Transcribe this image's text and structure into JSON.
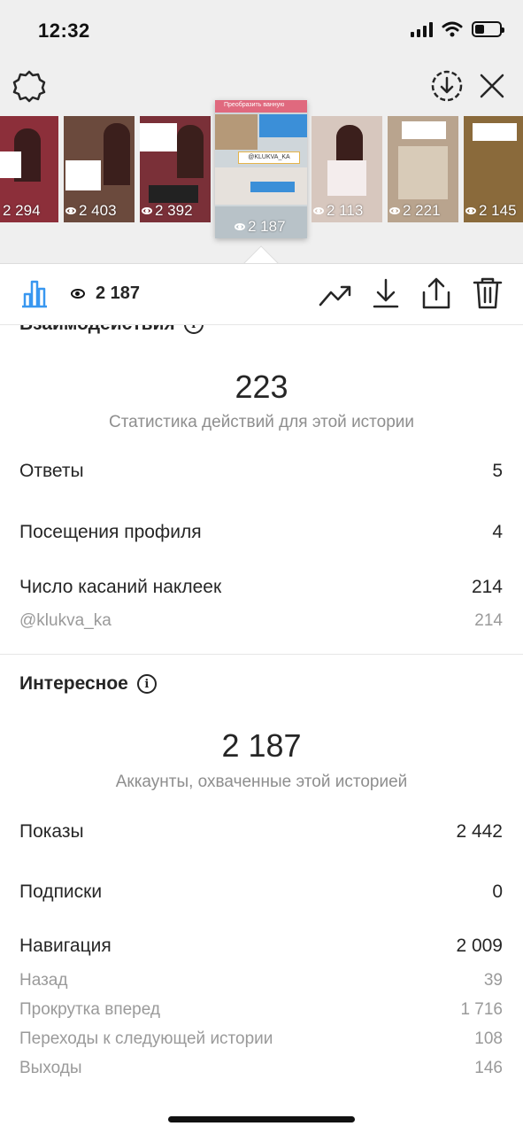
{
  "status": {
    "time": "12:32"
  },
  "stories": [
    {
      "views": "2 294",
      "bg": "#8c2f3a"
    },
    {
      "views": "2 403",
      "bg": "#6b4a3d"
    },
    {
      "views": "2 392",
      "bg": "#7a3038"
    },
    {
      "views": "2 187",
      "bg": "#cfd6da",
      "selected": true,
      "banner": "Преобразить ванную",
      "tag": "@KLUKVA_KA"
    },
    {
      "views": "2 113",
      "bg": "#d7c7be"
    },
    {
      "views": "2 221",
      "bg": "#b9a48e"
    },
    {
      "views": "2 145",
      "bg": "#8a6a3b"
    }
  ],
  "panel": {
    "views": "2 187"
  },
  "interactions": {
    "title": "Взаимодействия",
    "total": "223",
    "caption": "Статистика действий для этой истории",
    "rows": [
      {
        "label": "Ответы",
        "value": "5"
      },
      {
        "label": "Посещения профиля",
        "value": "4"
      },
      {
        "label": "Число касаний наклеек",
        "value": "214"
      }
    ],
    "sub": {
      "label": "@klukva_ka",
      "value": "214"
    }
  },
  "discovery": {
    "title": "Интересное",
    "total": "2 187",
    "caption": "Аккаунты, охваченные этой историей",
    "impressions": {
      "label": "Показы",
      "value": "2 442"
    },
    "follows": {
      "label": "Подписки",
      "value": "0"
    },
    "navigation": {
      "label": "Навигация",
      "value": "2 009"
    },
    "nav_rows": [
      {
        "label": "Назад",
        "value": "39"
      },
      {
        "label": "Прокрутка вперед",
        "value": "1 716"
      },
      {
        "label": "Переходы к следующей истории",
        "value": "108"
      },
      {
        "label": "Выходы",
        "value": "146"
      }
    ]
  },
  "colors": {
    "accent": "#3897f0",
    "text": "#262626",
    "muted": "#8e8e8e"
  }
}
